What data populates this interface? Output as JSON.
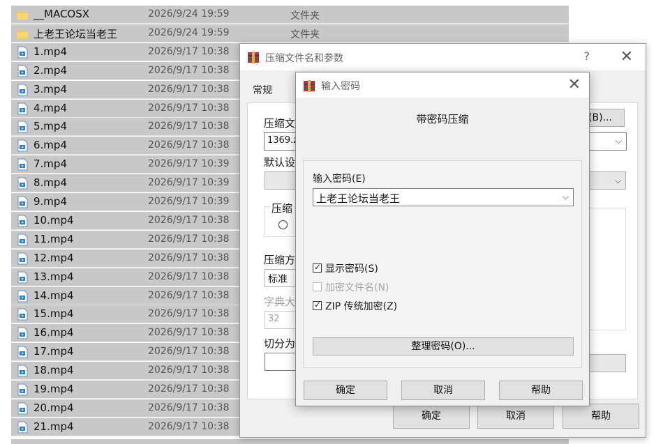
{
  "explorer": {
    "files": [
      {
        "name": "__MACOSX",
        "date": "2026/9/24 19:59",
        "type": "文件夹",
        "icon": "folder-icon"
      },
      {
        "name": "上老王论坛当老王",
        "date": "2026/9/24 19:59",
        "type": "文件夹",
        "icon": "folder-icon"
      },
      {
        "name": "1.mp4",
        "date": "2026/9/17 10:38",
        "type": "",
        "icon": "video-file-icon"
      },
      {
        "name": "2.mp4",
        "date": "2026/9/17 10:38",
        "type": "",
        "icon": "video-file-icon"
      },
      {
        "name": "3.mp4",
        "date": "2026/9/17 10:38",
        "type": "",
        "icon": "video-file-icon"
      },
      {
        "name": "4.mp4",
        "date": "2026/9/17 10:38",
        "type": "",
        "icon": "video-file-icon"
      },
      {
        "name": "5.mp4",
        "date": "2026/9/17 10:38",
        "type": "",
        "icon": "video-file-icon"
      },
      {
        "name": "6.mp4",
        "date": "2026/9/17 10:38",
        "type": "",
        "icon": "video-file-icon"
      },
      {
        "name": "7.mp4",
        "date": "2026/9/17 10:39",
        "type": "",
        "icon": "video-file-icon"
      },
      {
        "name": "8.mp4",
        "date": "2026/9/17 10:39",
        "type": "",
        "icon": "video-file-icon"
      },
      {
        "name": "9.mp4",
        "date": "2026/9/17 10:39",
        "type": "",
        "icon": "video-file-icon"
      },
      {
        "name": "10.mp4",
        "date": "2026/9/17 10:38",
        "type": "",
        "icon": "video-file-icon"
      },
      {
        "name": "11.mp4",
        "date": "2026/9/17 10:38",
        "type": "",
        "icon": "video-file-icon"
      },
      {
        "name": "12.mp4",
        "date": "2026/9/17 10:38",
        "type": "",
        "icon": "video-file-icon"
      },
      {
        "name": "13.mp4",
        "date": "2026/9/17 10:38",
        "type": "",
        "icon": "video-file-icon"
      },
      {
        "name": "14.mp4",
        "date": "2026/9/17 10:38",
        "type": "",
        "icon": "video-file-icon"
      },
      {
        "name": "15.mp4",
        "date": "2026/9/17 10:38",
        "type": "",
        "icon": "video-file-icon"
      },
      {
        "name": "16.mp4",
        "date": "2026/9/17 10:38",
        "type": "",
        "icon": "video-file-icon"
      },
      {
        "name": "17.mp4",
        "date": "2026/9/17 10:38",
        "type": "",
        "icon": "video-file-icon"
      },
      {
        "name": "18.mp4",
        "date": "2026/9/17 10:38",
        "type": "",
        "icon": "video-file-icon"
      },
      {
        "name": "19.mp4",
        "date": "2026/9/17 10:38",
        "type": "",
        "icon": "video-file-icon"
      },
      {
        "name": "20.mp4",
        "date": "2026/9/17 10:38",
        "type": "",
        "icon": "video-file-icon"
      },
      {
        "name": "21.mp4",
        "date": "2026/9/17 10:38",
        "type": "",
        "icon": "video-file-icon"
      }
    ]
  },
  "archive_dialog": {
    "title": "压缩文件名和参数",
    "help": "?",
    "close": "✕",
    "tab_general": "常规",
    "archive_name_label": "压缩文",
    "archive_name_value": "1369.z",
    "browse_label": "(B)...",
    "profile_label": "默认设",
    "format_group_label": "压缩",
    "format_option_partial": "",
    "method_label": "压缩方",
    "method_value": "标准",
    "dict_label": "字典大",
    "dict_value": "32",
    "split_label": "切分为",
    "ok_button": "确定",
    "cancel_button": "取消",
    "help_button": "帮助"
  },
  "password_dialog": {
    "title": "输入密码",
    "close": "✕",
    "heading": "带密码压缩",
    "password_label": "输入密码(E)",
    "password_value": "上老王论坛当老王",
    "show_password_label": "显示密码(S)",
    "show_password_checked": true,
    "encrypt_names_label": "加密文件名(N)",
    "encrypt_names_checked": false,
    "zip_legacy_label": "ZIP 传统加密(Z)",
    "zip_legacy_checked": true,
    "organize_button": "整理密码(O)...",
    "ok_button": "确定",
    "cancel_button": "取消",
    "help_button": "帮助"
  },
  "colors": {
    "selection_gray": "#c8c8c8",
    "folder_yellow": "#f6c64a",
    "video_blue": "#2f7fd0",
    "winrar_red": "#b8343a"
  }
}
